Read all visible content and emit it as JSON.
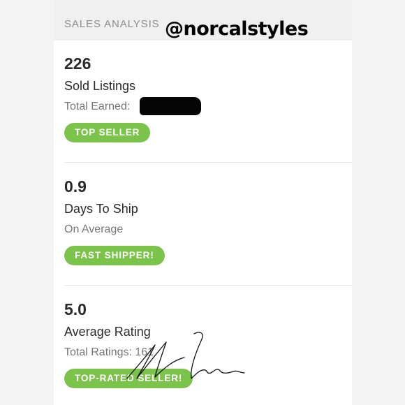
{
  "header": {
    "section_title": "SALES ANALYSIS",
    "watermark": "@norcalstyles"
  },
  "stats": [
    {
      "value": "226",
      "label": "Sold Listings",
      "sub": "Total Earned:",
      "badge": "TOP SELLER"
    },
    {
      "value": "0.9",
      "label": "Days To Ship",
      "sub": "On Average",
      "badge": "FAST SHIPPER!"
    },
    {
      "value": "5.0",
      "label": "Average Rating",
      "sub": "Total Ratings: 161",
      "badge": "TOP-RATED SELLER!"
    }
  ],
  "colors": {
    "badge_green": "#7cc34b",
    "page_background": "#f4f4f4",
    "card_background": "#ffffff",
    "redaction": "#050505"
  }
}
